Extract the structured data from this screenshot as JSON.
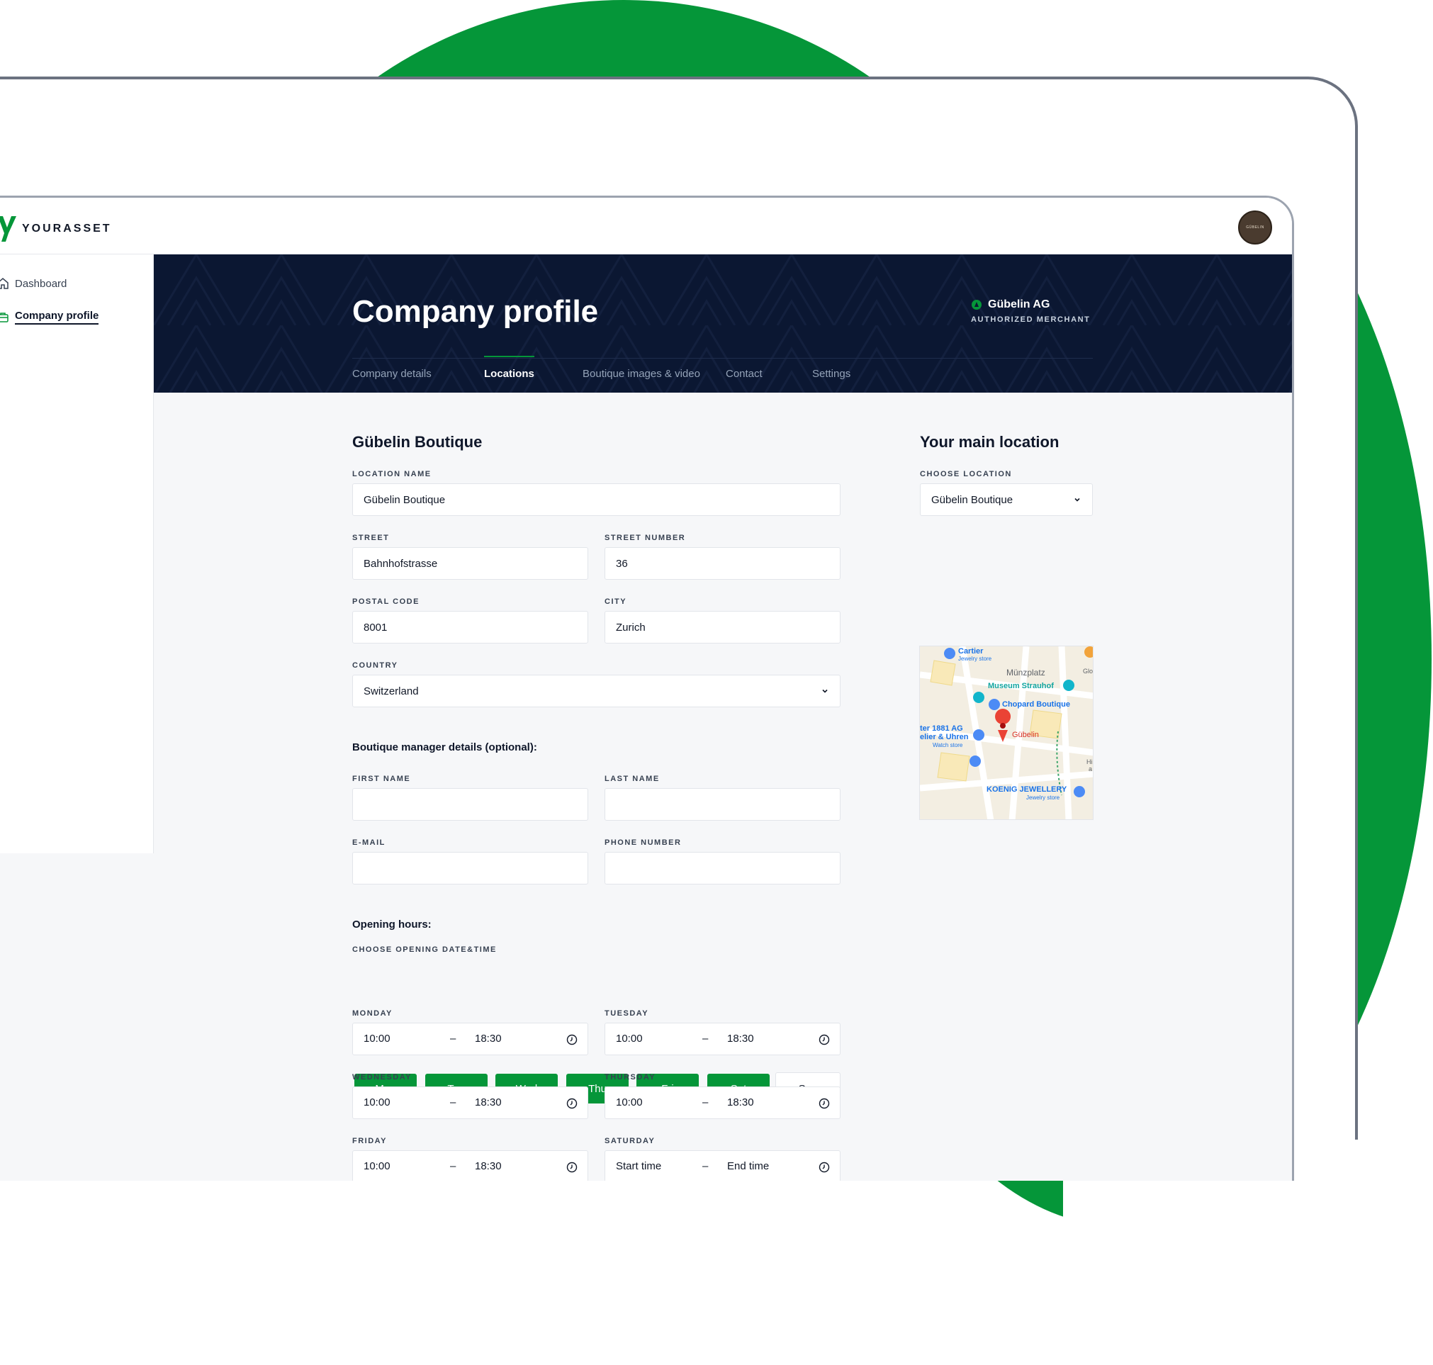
{
  "app": {
    "logo_text": "YOURASSET",
    "avatar_text": "GÜBELIN"
  },
  "sidebar": {
    "items": [
      {
        "label": "Dashboard",
        "icon": "home-icon"
      },
      {
        "label": "Company profile",
        "icon": "briefcase-icon"
      }
    ]
  },
  "header": {
    "title": "Company profile",
    "merchant_name": "Gübelin AG",
    "merchant_role": "AUTHORIZED MERCHANT",
    "tabs": [
      {
        "label": "Company details"
      },
      {
        "label": "Locations"
      },
      {
        "label": "Boutique images & video"
      },
      {
        "label": "Contact"
      },
      {
        "label": "Settings"
      }
    ],
    "active_tab": "Locations"
  },
  "location_form": {
    "title": "Gübelin Boutique",
    "location_name_label": "LOCATION NAME",
    "location_name": "Gübelin Boutique",
    "street_label": "STREET",
    "street": "Bahnhofstrasse",
    "street_number_label": "STREET NUMBER",
    "street_number": "36",
    "postal_code_label": "POSTAL CODE",
    "postal_code": "8001",
    "city_label": "CITY",
    "city": "Zurich",
    "country_label": "COUNTRY",
    "country": "Switzerland"
  },
  "manager": {
    "heading": "Boutique manager details (optional):",
    "first_name_label": "FIRST NAME",
    "first_name": "",
    "last_name_label": "LAST NAME",
    "last_name": "",
    "email_label": "E-MAIL",
    "email": "",
    "phone_label": "PHONE NUMBER",
    "phone": ""
  },
  "hours": {
    "heading": "Opening hours:",
    "choose_label": "CHOOSE OPENING DATE&TIME",
    "days": [
      {
        "label": "Mon",
        "selected": true
      },
      {
        "label": "Tue",
        "selected": true
      },
      {
        "label": "Wed",
        "selected": true
      },
      {
        "label": "Thu",
        "selected": true
      },
      {
        "label": "Fri",
        "selected": true
      },
      {
        "label": "Sat",
        "selected": true
      },
      {
        "label": "Sun",
        "selected": false
      }
    ],
    "dash": "–",
    "rows": [
      {
        "day": "MONDAY",
        "start": "10:00",
        "end": "18:30"
      },
      {
        "day": "TUESDAY",
        "start": "10:00",
        "end": "18:30"
      },
      {
        "day": "WEDNESDAY",
        "start": "10:00",
        "end": "18:30"
      },
      {
        "day": "THURSDAY",
        "start": "10:00",
        "end": "18:30"
      },
      {
        "day": "FRIDAY",
        "start": "10:00",
        "end": "18:30"
      },
      {
        "day": "SATURDAY",
        "start": "Start time",
        "end": "End time"
      }
    ]
  },
  "main_location": {
    "title": "Your main location",
    "choose_label": "CHOOSE LOCATION",
    "selected": "Gübelin Boutique",
    "map_labels": {
      "cartier": "Cartier",
      "cartier_sub": "Jewelry store",
      "munzplatz": "Münzplatz",
      "glocke": "Glocke",
      "museum": "Museum Strauhof",
      "chopard": "Chopard Boutique",
      "ter1881": "ter 1881 AG",
      "elier": "elier & Uhren",
      "watch_store": "Watch store",
      "gubelin": "Gübelin",
      "koenig": "KOENIG JEWELLERY",
      "koenig_sub": "Jewelry store",
      "hi": "Hi",
      "a": "a"
    }
  },
  "colors": {
    "brand_green": "#059639",
    "banner_navy": "#0b1732"
  }
}
